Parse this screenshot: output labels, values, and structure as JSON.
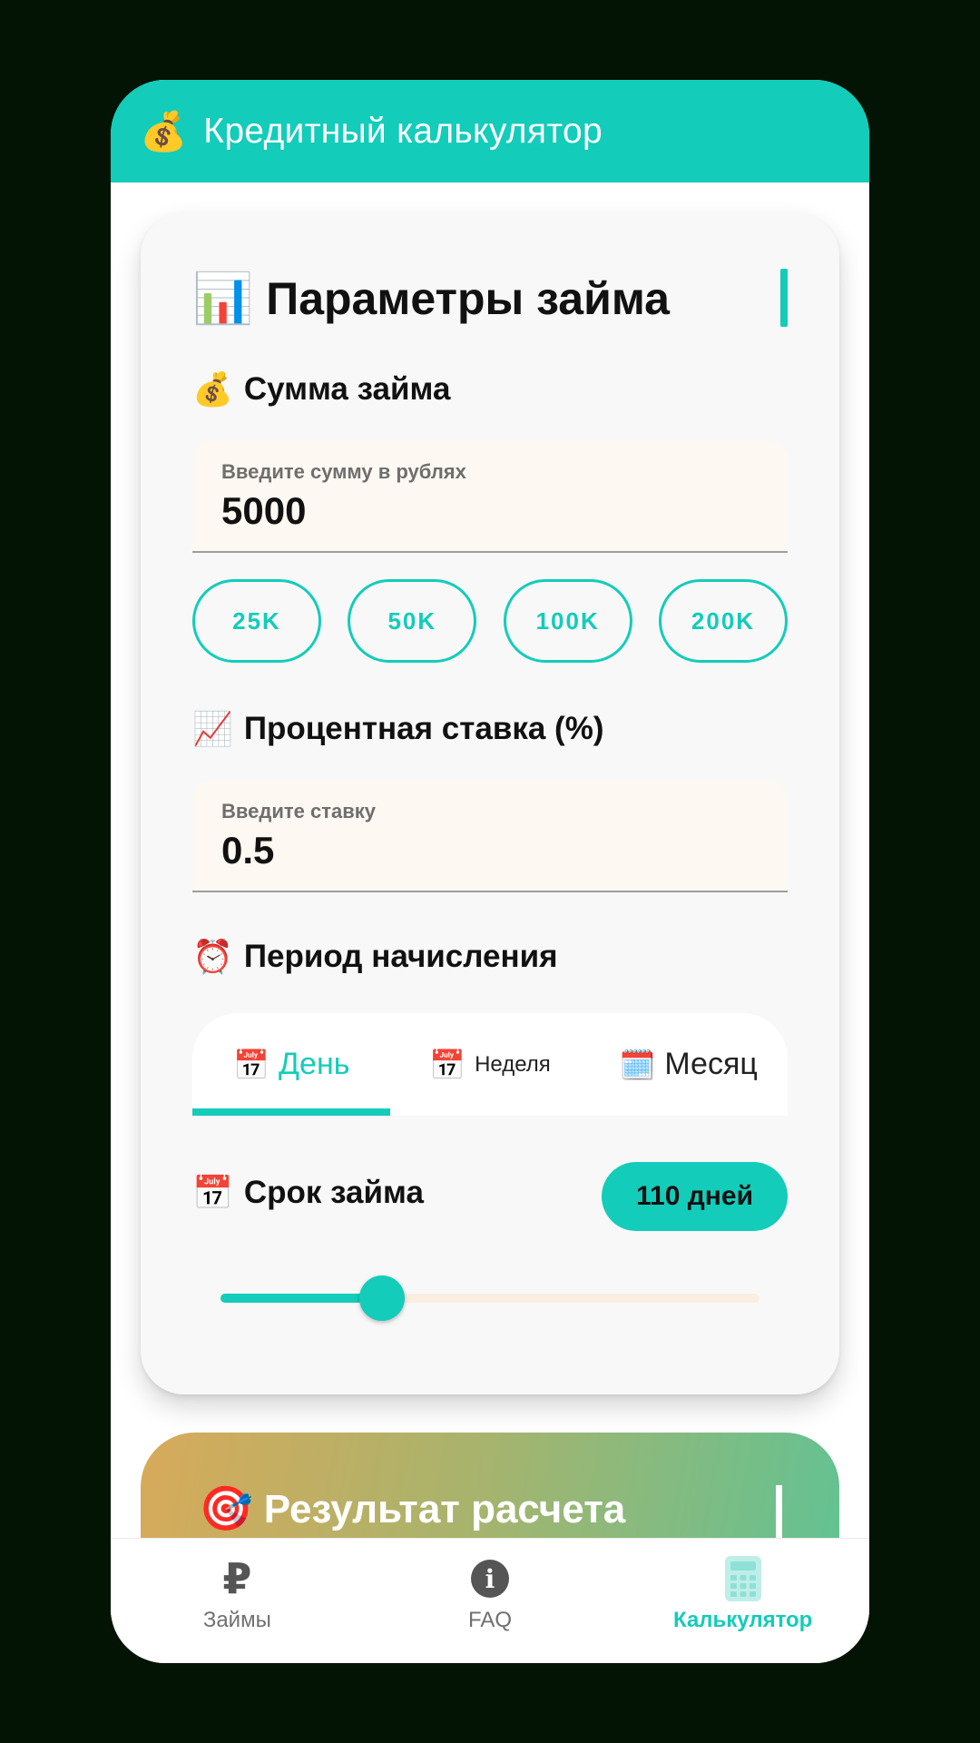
{
  "app_bar": {
    "emoji": "💰",
    "title": "Кредитный калькулятор"
  },
  "loan_params": {
    "emoji": "📊",
    "title": "Параметры займа",
    "amount": {
      "emoji": "💰",
      "label": "Сумма займа",
      "hint": "Введите сумму в рублях",
      "value": "5000",
      "quick_amounts": [
        "25K",
        "50K",
        "100K",
        "200K"
      ]
    },
    "rate": {
      "emoji": "📈",
      "label": "Процентная ставка (%)",
      "hint": "Введите ставку",
      "value": "0.5"
    },
    "period": {
      "emoji": "⏰",
      "label": "Период начисления",
      "tabs": [
        {
          "emoji": "📅",
          "label": "День",
          "selected": true
        },
        {
          "emoji": "📅",
          "label": "Неделя",
          "selected": false
        },
        {
          "emoji": "🗓️",
          "label": "Месяц",
          "selected": false
        }
      ]
    },
    "term": {
      "emoji": "📅",
      "label": "Срок займа",
      "value_label": "110 дней",
      "slider_fraction": 0.3
    }
  },
  "result": {
    "emoji": "🎯",
    "title": "Результат расчета"
  },
  "bottom_nav": {
    "items": [
      {
        "icon": "ruble-icon",
        "glyph": "₽",
        "label": "Займы",
        "active": false
      },
      {
        "icon": "info-icon",
        "glyph": "i",
        "label": "FAQ",
        "active": false
      },
      {
        "icon": "calculator-icon",
        "label": "Калькулятор",
        "active": true
      }
    ]
  },
  "colors": {
    "accent": "#13ccba",
    "background": "#041404",
    "field": "#fdf8f2"
  }
}
